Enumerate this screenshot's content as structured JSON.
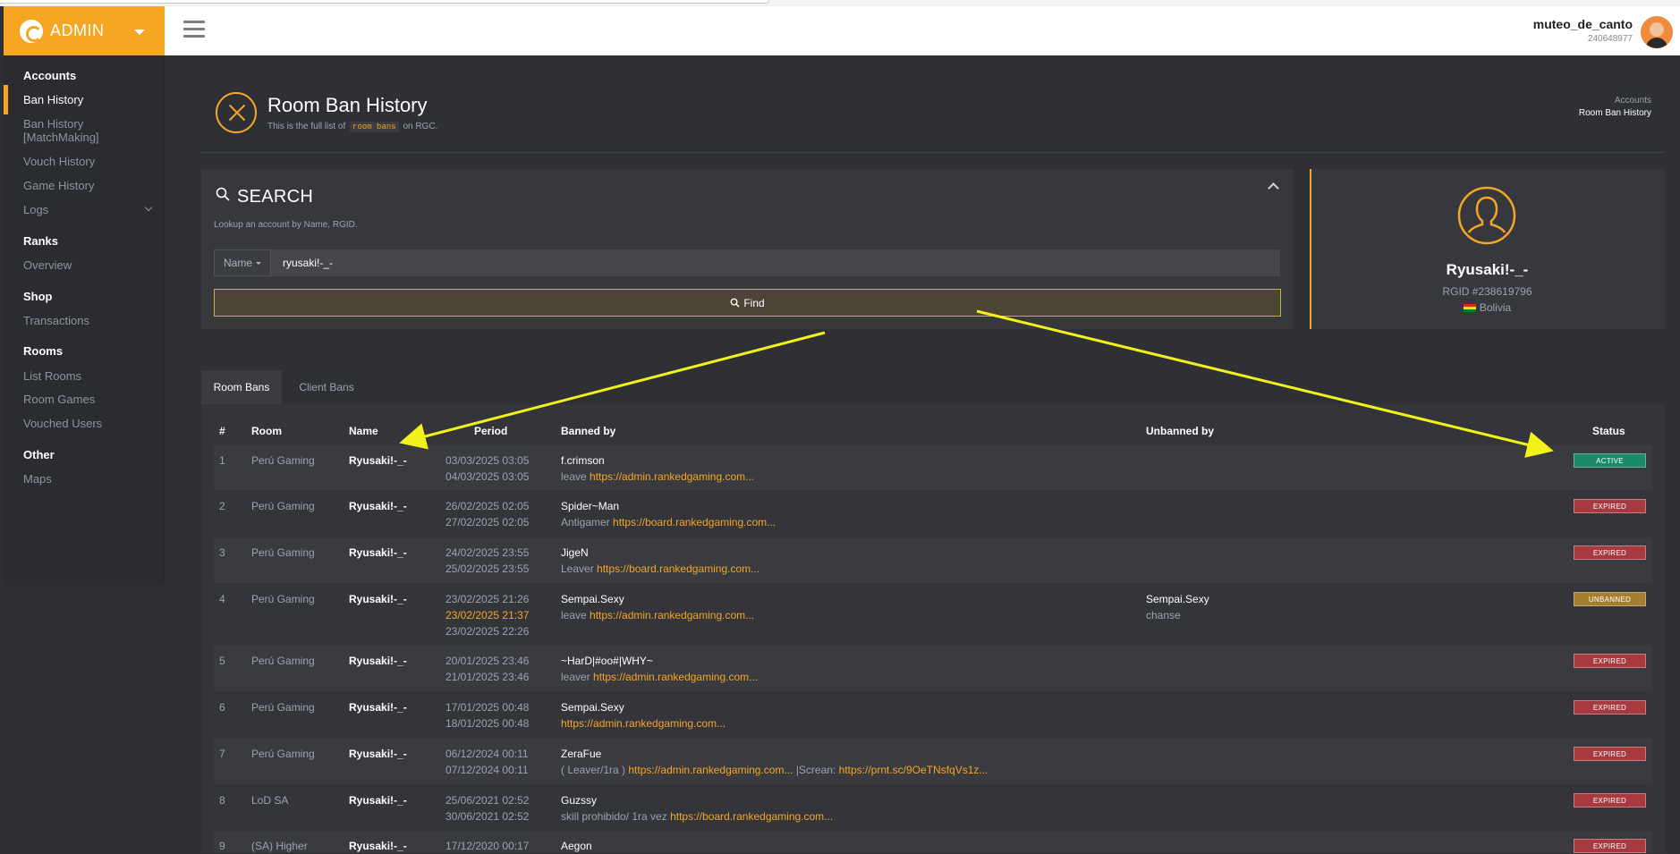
{
  "brand": {
    "label": "ADMIN"
  },
  "user": {
    "name": "muteo_de_canto",
    "id": "240648977"
  },
  "sidebar": {
    "sections": [
      {
        "title": "Accounts",
        "items": [
          "Ban History",
          "Ban History",
          "[MatchMaking]",
          "Vouch History",
          "Game History",
          "Logs"
        ]
      },
      {
        "title": "Ranks",
        "items": [
          "Overview"
        ]
      },
      {
        "title": "Shop",
        "items": [
          "Transactions"
        ]
      },
      {
        "title": "Rooms",
        "items": [
          "List Rooms",
          "Room Games",
          "Vouched Users"
        ]
      },
      {
        "title": "Other",
        "items": [
          "Maps"
        ]
      }
    ]
  },
  "page": {
    "title": "Room Ban History",
    "sub_prefix": "This is the full list of",
    "sub_code": "room bans",
    "sub_suffix": "on RGC.",
    "breadcrumb": [
      "Accounts",
      "Room Ban History"
    ]
  },
  "search": {
    "title": "SEARCH",
    "description": "Lookup an account by Name, RGID.",
    "field_type": "Name",
    "value": "ryusaki!-_-",
    "button": "Find"
  },
  "profile": {
    "name": "Ryusaki!-_-",
    "rgid": "RGID #238619796",
    "country": "Bolivia"
  },
  "tabs": [
    "Room Bans",
    "Client Bans"
  ],
  "table": {
    "columns": [
      "#",
      "Room",
      "Name",
      "Period",
      "Banned by",
      "Unbanned by",
      "Status"
    ],
    "rows": [
      {
        "num": "1",
        "room": "Perú Gaming",
        "name": "Ryusaki!-_-",
        "p1": "03/03/2025",
        "t1": "03:05",
        "p2": "04/03/2025",
        "t2": "03:05",
        "by": "f.crimson",
        "reason": "leave",
        "link": "https://admin.rankedgaming.com...",
        "status": "ACTIVE"
      },
      {
        "num": "2",
        "room": "Perú Gaming",
        "name": "Ryusaki!-_-",
        "p1": "26/02/2025",
        "t1": "02:05",
        "p2": "27/02/2025",
        "t2": "02:05",
        "by": "Spider~Man",
        "reason": "Antigamer",
        "link": "https://board.rankedgaming.com...",
        "status": "EXPIRED"
      },
      {
        "num": "3",
        "room": "Perú Gaming",
        "name": "Ryusaki!-_-",
        "p1": "24/02/2025",
        "t1": "23:55",
        "p2": "25/02/2025",
        "t2": "23:55",
        "by": "JigeN",
        "reason": "Leaver",
        "link": "https://board.rankedgaming.com...",
        "status": "EXPIRED"
      },
      {
        "num": "4",
        "room": "Perú Gaming",
        "name": "Ryusaki!-_-",
        "p1": "23/02/2025",
        "t1": "21:26",
        "p2": "23/02/2025",
        "t2": "21:37",
        "p3": "23/02/2025",
        "t3": "22:26",
        "by": "Sempai.Sexy",
        "reason": "leave",
        "link": "https://admin.rankedgaming.com...",
        "unbanned_by": "Sempai.Sexy",
        "unban_reason": "chanse",
        "status": "UNBANNED"
      },
      {
        "num": "5",
        "room": "Perú Gaming",
        "name": "Ryusaki!-_-",
        "p1": "20/01/2025",
        "t1": "23:46",
        "p2": "21/01/2025",
        "t2": "23:46",
        "by": "~HarD|#oo#|WHY~",
        "reason": "leaver",
        "link": "https://admin.rankedgaming.com...",
        "status": "EXPIRED"
      },
      {
        "num": "6",
        "room": "Perú Gaming",
        "name": "Ryusaki!-_-",
        "p1": "17/01/2025",
        "t1": "00:48",
        "p2": "18/01/2025",
        "t2": "00:48",
        "by": "Sempai.Sexy",
        "reason": "",
        "link": "https://admin.rankedgaming.com...",
        "status": "EXPIRED"
      },
      {
        "num": "7",
        "room": "Perú Gaming",
        "name": "Ryusaki!-_-",
        "p1": "06/12/2024",
        "t1": "00:11",
        "p2": "07/12/2024",
        "t2": "00:11",
        "by": "ZeraFue",
        "reason": "( Leaver/1ra )",
        "link": "https://admin.rankedgaming.com...",
        "reason2": "|Screan:",
        "link2": "https://prnt.sc/9OeTNsfqVs1z...",
        "status": "EXPIRED"
      },
      {
        "num": "8",
        "room": "LoD SA",
        "name": "Ryusaki!-_-",
        "p1": "25/06/2021",
        "t1": "02:52",
        "p2": "30/06/2021",
        "t2": "02:52",
        "by": "Guzssy",
        "reason": "skill prohibido/ 1ra vez",
        "link": "https://board.rankedgaming.com...",
        "status": "EXPIRED"
      },
      {
        "num": "9",
        "room": "(SA) Higher",
        "name": "Ryusaki!-_-",
        "p1": "17/12/2020",
        "t1": "00:17",
        "by": "Aegon",
        "status": "EXPIRED"
      }
    ]
  },
  "colors": {
    "accent": "#f5a623",
    "active": "#1d8a67",
    "expired": "#a63a3f",
    "unbanned": "#a37f2e",
    "annotation": "#f2f21a"
  }
}
